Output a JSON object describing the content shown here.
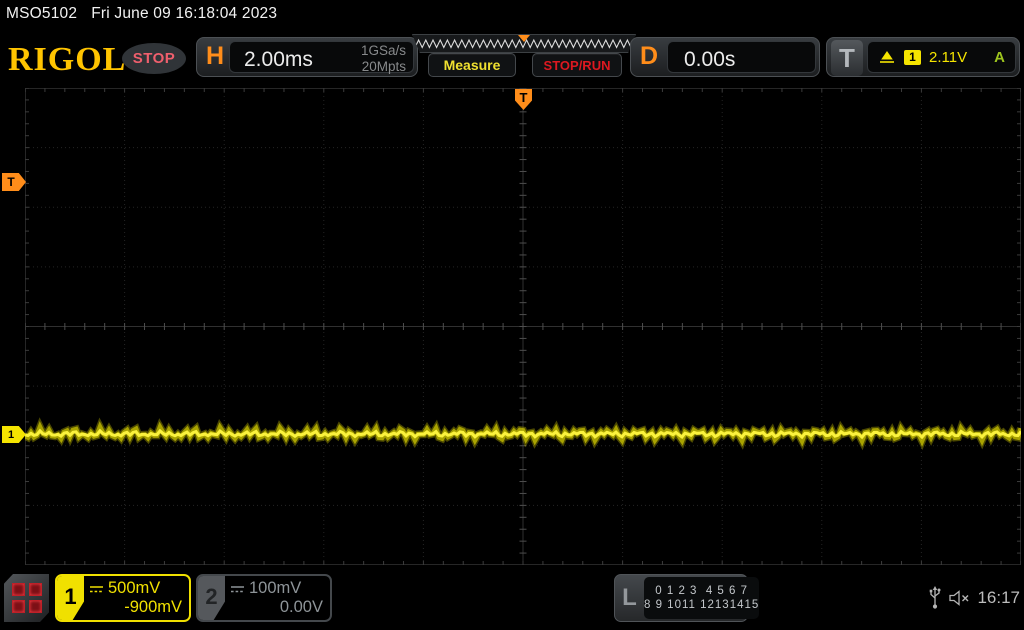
{
  "status_bar": {
    "model": "MSO5102",
    "datetime": "Fri June 09 16:18:04 2023"
  },
  "header": {
    "brand": "RIGOL",
    "acquisition_status": "STOP",
    "horizontal": {
      "label": "H",
      "timebase": "2.00ms",
      "sample_rate": "1GSa/s",
      "memory_depth": "20Mpts"
    },
    "buttons": {
      "measure": "Measure",
      "stop_run": "STOP/RUN"
    },
    "delay": {
      "label": "D",
      "value": "0.00s"
    },
    "trigger": {
      "label": "T",
      "source_channel": "1",
      "level": "2.11V",
      "mode": "A"
    }
  },
  "graticule": {
    "h_divisions": 10,
    "v_divisions": 8,
    "trigger_position_label": "T",
    "trigger_level_label": "T",
    "channel1_position_label": "1",
    "trace": {
      "channel": 1,
      "shape": "flat noisy line",
      "color": "#f8ee00"
    }
  },
  "bottom_bar": {
    "channel1": {
      "number": "1",
      "scale": "500mV",
      "offset": "-900mV"
    },
    "channel2": {
      "number": "2",
      "scale": "100mV",
      "offset": "0.00V"
    },
    "logic": {
      "label": "L",
      "row1": "0 1 2 3  4 5 6 7",
      "row2": "8 9 1011 12131415"
    },
    "clock": "16:17"
  },
  "icons": {
    "menu": "menu-grid-icon",
    "dc_coupling": "dc-coupling-icon",
    "trigger_slope": "rising-edge-trigger-icon",
    "usb": "usb-icon",
    "sound": "speaker-muted-icon"
  },
  "colors": {
    "accent_orange": "#ff8d1a",
    "channel1_yellow": "#f0e000",
    "channel2_gray": "#8e9498",
    "trigger_mode_green": "#9dc41e",
    "stop_badge_red": "#ef5f6d",
    "run_stop_red": "#dd1820",
    "brand_gold": "#ffc400",
    "trace_yellow": "#f8ee00"
  }
}
